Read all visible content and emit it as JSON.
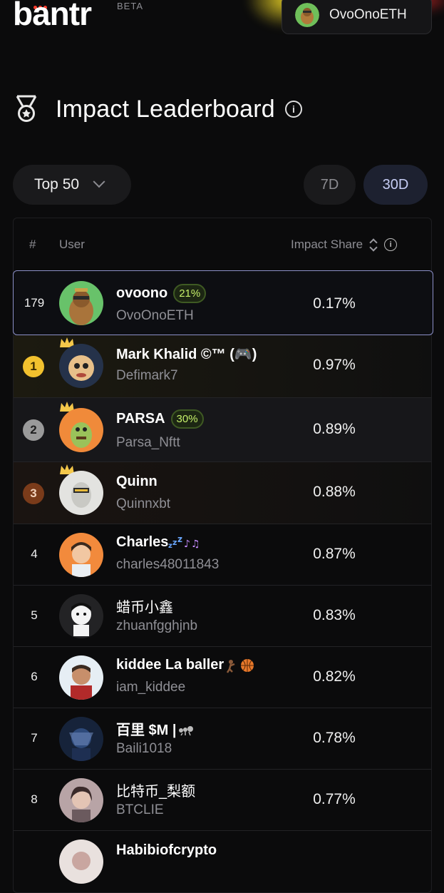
{
  "brand": {
    "name": "bantr",
    "tag": "BETA"
  },
  "account": {
    "name": "OvoOnoETH"
  },
  "page": {
    "title": "Impact Leaderboard"
  },
  "filters": {
    "top_label": "Top 50",
    "range_7d": "7D",
    "range_30d": "30D",
    "selected_range": "30D"
  },
  "table": {
    "headers": {
      "rank": "#",
      "user": "User",
      "impact": "Impact Share"
    },
    "current_user": {
      "rank": "179",
      "name": "ovoono",
      "badge": "21%",
      "handle": "OvoOnoETH",
      "share": "0.17%"
    },
    "rows": [
      {
        "rank": "1",
        "name": "Mark Khalid ©™ (🎮)",
        "handle": "Defimark7",
        "share": "0.97%"
      },
      {
        "rank": "2",
        "name": "PARSA",
        "badge": "30%",
        "handle": "Parsa_Nftt",
        "share": "0.89%"
      },
      {
        "rank": "3",
        "name": "Quinn",
        "handle": "Quinnxbt",
        "share": "0.88%"
      },
      {
        "rank": "4",
        "name": "Charles",
        "handle": "charles48011843",
        "share": "0.87%"
      },
      {
        "rank": "5",
        "name": "蜡币小鑫",
        "handle": "zhuanfgghjnb",
        "share": "0.83%"
      },
      {
        "rank": "6",
        "name": "kiddee La baller",
        "handle": "iam_kiddee",
        "share": "0.82%"
      },
      {
        "rank": "7",
        "name": "百里 $M |",
        "handle": "Baili1018",
        "share": "0.78%"
      },
      {
        "rank": "8",
        "name": "比特币_梨额",
        "handle": "BTCLIE",
        "share": "0.77%"
      },
      {
        "rank": "",
        "name": "Habibiofcrypto",
        "handle": "",
        "share": ""
      }
    ]
  },
  "colors": {
    "accent": "#8c90c8",
    "gold": "#f2c12e",
    "silver": "#9a9a9a",
    "bronze": "#7a3b1a",
    "badge_green": "#c6f06a"
  }
}
